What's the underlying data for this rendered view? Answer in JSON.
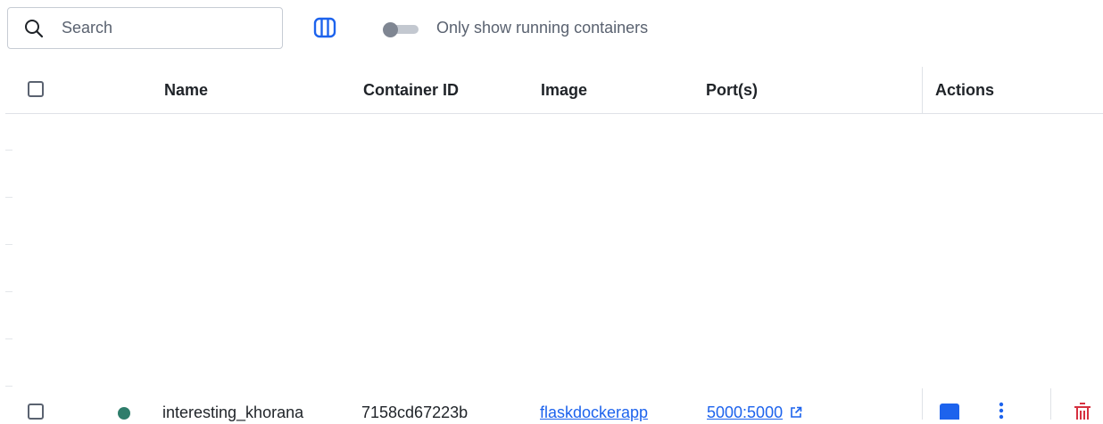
{
  "toolbar": {
    "search_placeholder": "Search",
    "toggle_label": "Only show running containers",
    "toggle_on": false
  },
  "table": {
    "columns": [
      "Name",
      "Container ID",
      "Image",
      "Port(s)",
      "Actions"
    ],
    "rows": [
      {
        "status": "running",
        "name": "interesting_khorana",
        "container_id": "7158cd67223b",
        "image": "flaskdockerapp",
        "ports": "5000:5000"
      }
    ]
  },
  "icons": {
    "search": "search-icon",
    "columns": "columns-icon",
    "external_link": "external-link-icon",
    "stop": "stop-icon",
    "more": "more-vertical-icon",
    "delete": "trash-icon"
  },
  "colors": {
    "accent": "#1d63ed",
    "running_status": "#2e7d6b",
    "delete": "#d6303f",
    "muted_text": "#5a6270"
  }
}
